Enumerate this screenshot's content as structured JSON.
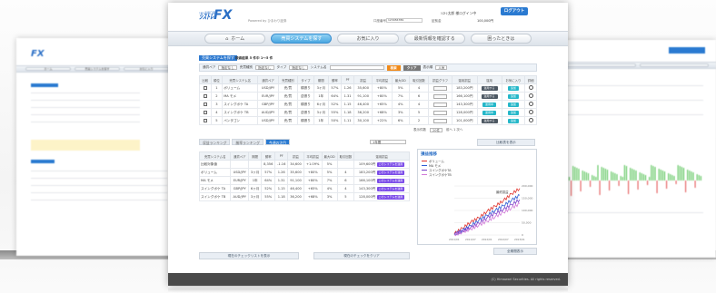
{
  "brand": {
    "logo_main": "FX",
    "logo_prefix": "ｼｽﾄﾚ",
    "logo_small": "ｼｽﾄﾚ専用口座",
    "tagline": "Powered by ひまわり証券"
  },
  "header": {
    "login_name": "ｼｽﾄﾚ太郎 様ログイン中",
    "logout_label": "ログアウト",
    "field_label": "口座番号",
    "field_value": "123456789",
    "balance_label": "証拠金",
    "balance_value": "100,000円"
  },
  "nav": {
    "items": [
      "ホーム",
      "売買システムを探す",
      "お気に入り",
      "最新情報を確認する",
      "困ったときは"
    ]
  },
  "search": {
    "tag": "売買システムを探す",
    "tag_sub": "検索結果 5 件中 1〜5 件",
    "filter1_label": "通貨ペア",
    "filter1_value": "指定なし",
    "filter2_label": "売買種別",
    "filter2_value": "指定なし",
    "filter3_label": "タイプ",
    "filter3_value": "指定なし",
    "keyword_label": "システム名",
    "search_btn": "検索",
    "reset_btn": "クリア",
    "sort_label": "表示順",
    "sort_value": "人気"
  },
  "table": {
    "headers": [
      "比較",
      "順位",
      "売買システム名",
      "通貨ペア",
      "売買種別",
      "タイプ",
      "期間",
      "勝率",
      "PF",
      "損益",
      "平均損益",
      "最大DD",
      "取引回数",
      "損益グラフ",
      "運用損益",
      "運用",
      "お気に入り",
      "詳細"
    ],
    "rows": [
      {
        "rank": "1",
        "name": "ボリューム",
        "pair": "USD/JPY",
        "side": "売/買",
        "type": "順張り",
        "period": "3ヶ月",
        "win": "57%",
        "pf": "1.26",
        "pl": "35,600",
        "avg": "+80%",
        "dd": "5%",
        "trades": "4",
        "result": "183,200円",
        "b1": "運用する",
        "b2": "追加"
      },
      {
        "rank": "2",
        "name": "MA モメ",
        "pair": "EUR/JPY",
        "side": "売/買",
        "type": "逆張り",
        "period": "1年",
        "win": "64%",
        "pf": "1.31",
        "pl": "91,100",
        "avg": "+80%",
        "dd": "7%",
        "trades": "6",
        "result": "166,100円",
        "b1": "運用する",
        "b2": "追加"
      },
      {
        "rank": "3",
        "name": "スイングポケ TA",
        "pair": "GBP/JPY",
        "side": "売/買",
        "type": "順張り",
        "period": "6ヶ月",
        "win": "52%",
        "pf": "1.15",
        "pl": "46,400",
        "avg": "+65%",
        "dd": "4%",
        "trades": "4",
        "result": "143,300円",
        "b1": "運用中",
        "b2": "追加"
      },
      {
        "rank": "4",
        "name": "スイングポケ TB",
        "pair": "AUD/JPY",
        "side": "売/買",
        "type": "逆張り",
        "period": "3ヶ月",
        "win": "55%",
        "pf": "1.18",
        "pl": "36,200",
        "avg": "+68%",
        "dd": "3%",
        "trades": "5",
        "result": "128,000円",
        "b1": "運用中",
        "b2": "追加"
      },
      {
        "rank": "5",
        "name": "ペンタゴン",
        "pair": "USD/JPY",
        "side": "売/買",
        "type": "順張り",
        "period": "1年",
        "win": "50%",
        "pf": "1.11",
        "pl": "30,100",
        "avg": "+22%",
        "dd": "6%",
        "trades": "2",
        "result": "101,000円",
        "b1": "運用する",
        "b2": "追加"
      }
    ],
    "pager": "表示件数",
    "pager_value": "20件",
    "pager_text": "前へ 1 次へ"
  },
  "ranking": {
    "tabs": [
      "収益ランキング",
      "勝率ランキング",
      "今週の注目"
    ],
    "period_value": "1年間",
    "compare_btn": "比較表を表示",
    "headers": [
      "売買システム名",
      "通貨ペア",
      "期間",
      "勝率",
      "PF",
      "損益",
      "平均損益",
      "最大DD",
      "取引回数",
      "運用損益"
    ],
    "rows": [
      {
        "name": "比較対象値",
        "pair": "",
        "period": "",
        "win": "8,356",
        "pf": "-1.16",
        "pl": "34,600",
        "avg": "+1.09%",
        "dd": "5%",
        "trades": "",
        "result": "109,600円",
        "btn": "このシステムを運用"
      },
      {
        "name": "ボリューム",
        "pair": "USD/JPY",
        "period": "3ヶ月",
        "win": "57%",
        "pf": "1.26",
        "pl": "35,600",
        "avg": "+80%",
        "dd": "5%",
        "trades": "4",
        "result": "183,200円",
        "btn": "このシステムを運用"
      },
      {
        "name": "MA モメ",
        "pair": "EUR/JPY",
        "period": "1年",
        "win": "64%",
        "pf": "1.31",
        "pl": "91,100",
        "avg": "+80%",
        "dd": "7%",
        "trades": "6",
        "result": "166,100円",
        "btn": "このシステムを運用"
      },
      {
        "name": "スイングポケ TA",
        "pair": "GBP/JPY",
        "period": "6ヶ月",
        "win": "52%",
        "pf": "1.15",
        "pl": "46,400",
        "avg": "+65%",
        "dd": "4%",
        "trades": "4",
        "result": "143,300円",
        "btn": "このシステムを運用"
      },
      {
        "name": "スイングポケ TB",
        "pair": "AUD/JPY",
        "period": "3ヶ月",
        "win": "55%",
        "pf": "1.18",
        "pl": "36,200",
        "avg": "+68%",
        "dd": "3%",
        "trades": "5",
        "result": "128,000円",
        "btn": "このシステムを運用"
      }
    ],
    "footer_left": "現在のチェックリストを表示",
    "footer_right": "現在のチェックをクリア"
  },
  "chart": {
    "title": "損益推移",
    "top_right": "全期間表示",
    "legend": [
      {
        "name": "ボリューム",
        "color": "#e0322b"
      },
      {
        "name": "MA モメ",
        "color": "#2d5bd4"
      },
      {
        "name": "スイングポケTA",
        "color": "#7a3fc8"
      },
      {
        "name": "スイングポケTB",
        "color": "#d17ad8"
      }
    ],
    "x_ticks": [
      "2011/01",
      "2011/07",
      "2012/01",
      "2012/07",
      "2013/01"
    ],
    "y_ticks": [
      "200,000",
      "150,000",
      "100,000",
      "50,000",
      "0"
    ],
    "end_label": "最終損益"
  },
  "footer": {
    "text": "(C) Himawari Securities. All rights reserved."
  },
  "chart_data": {
    "type": "line",
    "title": "損益推移",
    "x": [
      "2011/01",
      "2011/04",
      "2011/07",
      "2011/10",
      "2012/01",
      "2012/04",
      "2012/07",
      "2012/10",
      "2013/01"
    ],
    "series": [
      {
        "name": "ボリューム",
        "values": [
          5000,
          28000,
          52000,
          70000,
          96000,
          118000,
          140000,
          168000,
          190000
        ]
      },
      {
        "name": "MA モメ",
        "values": [
          3000,
          18000,
          38000,
          60000,
          80000,
          100000,
          120000,
          142000,
          162000
        ]
      },
      {
        "name": "スイングポケTA",
        "values": [
          2000,
          16000,
          30000,
          48000,
          70000,
          88000,
          104000,
          124000,
          144000
        ]
      },
      {
        "name": "スイングポケTB",
        "values": [
          1000,
          12000,
          24000,
          40000,
          56000,
          74000,
          92000,
          110000,
          128000
        ]
      }
    ],
    "ylim": [
      0,
      200000
    ]
  }
}
